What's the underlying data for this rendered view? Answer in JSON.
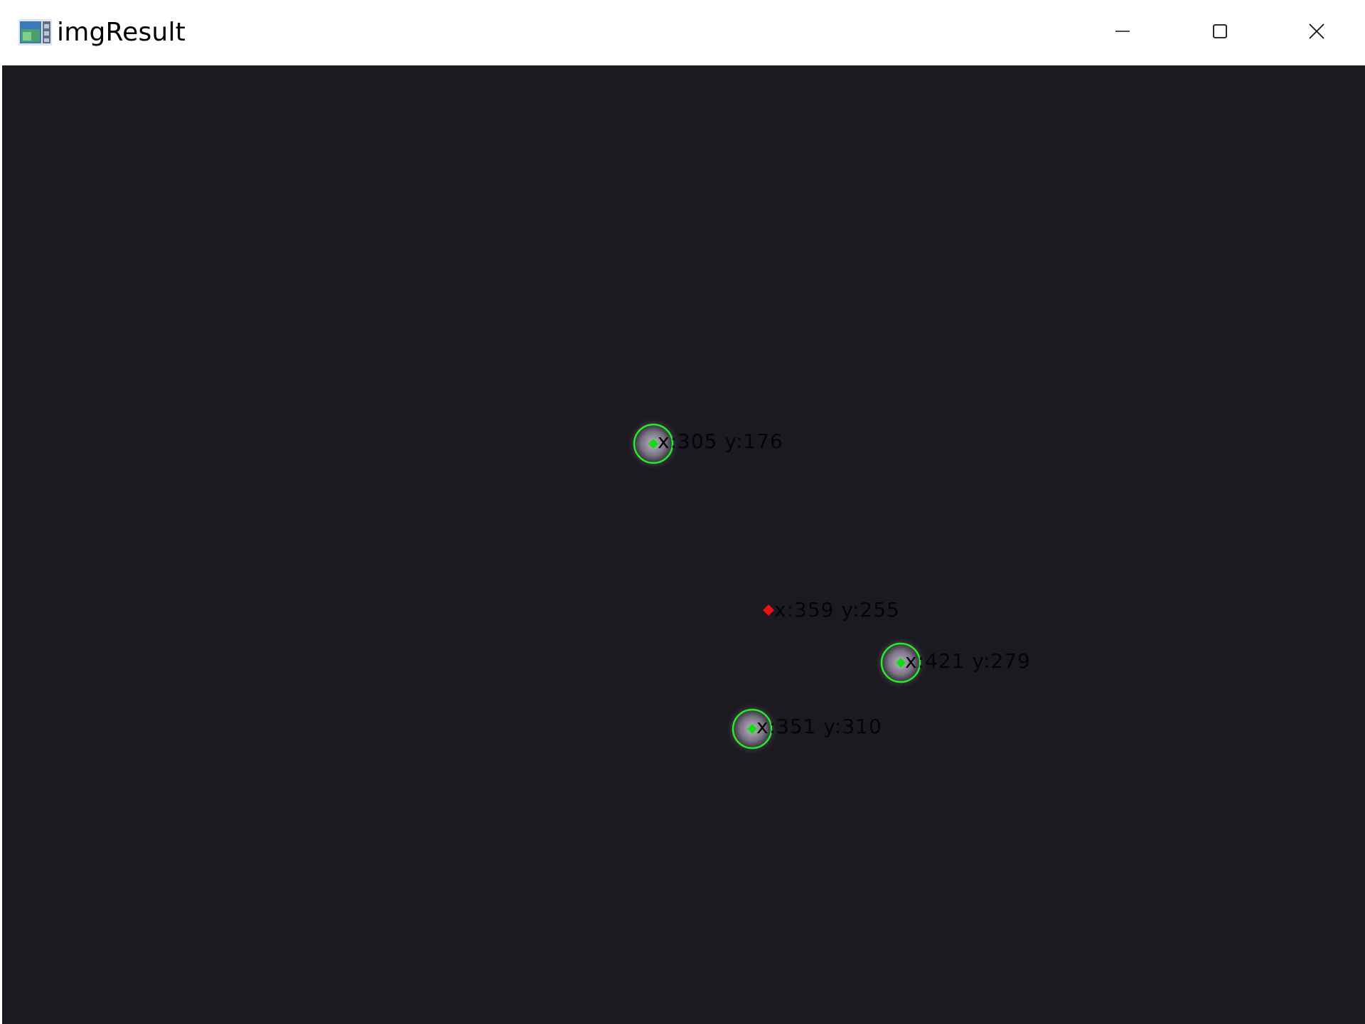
{
  "window": {
    "title": "imgResult",
    "controls": {
      "minimize": "minimize",
      "maximize": "maximize",
      "close": "close"
    }
  },
  "image": {
    "background_color": "#1c1a20",
    "circle_color": "#22ee22",
    "center_marker_color": "#11dd11",
    "centroid_marker_color": "#ee1111",
    "detections": [
      {
        "label": "x:305  y:176"
      },
      {
        "label": "x:421  y:279"
      },
      {
        "label": "x:351  y:310"
      }
    ],
    "centroid": {
      "label": "x:359  y:255"
    }
  }
}
